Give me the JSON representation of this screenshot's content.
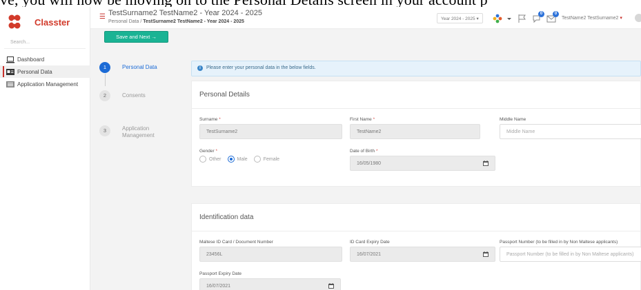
{
  "banner": {
    "text": "ve, you will now be moving on to the Personal Details screen in your account p"
  },
  "brand": {
    "name": "Classter",
    "color": "#d23a2a"
  },
  "sidebar": {
    "search_placeholder": "Search...",
    "items": [
      {
        "label": "Dashboard",
        "icon": "monitor-icon"
      },
      {
        "label": "Personal Data",
        "icon": "id-card-icon"
      },
      {
        "label": "Application Management",
        "icon": "list-icon"
      }
    ]
  },
  "header": {
    "title": "TestSurname2 TestName2 - Year 2024 - 2025",
    "breadcrumb_root": "Personal Data",
    "breadcrumb_sep": "/",
    "breadcrumb_current": "TestSurname2 TestName2 - Year 2024 - 2025",
    "year_select": "Year 2024 - 2025",
    "user_name": "TestName2 TestSurname2",
    "chat_badge": "0",
    "mail_badge": "0"
  },
  "actions": {
    "save_next": "Save and Next →"
  },
  "steps": [
    {
      "number": "1",
      "label": "Personal Data"
    },
    {
      "number": "2",
      "label": "Consents"
    },
    {
      "number": "3",
      "label": "Application Management"
    }
  ],
  "alert": {
    "text": "Please enter your personal data in the below fields."
  },
  "personal": {
    "title": "Personal Details",
    "surname_label": "Surname",
    "surname_value": "TestSurname2",
    "firstname_label": "First Name",
    "firstname_value": "TestName2",
    "middlename_label": "Middle Name",
    "middlename_placeholder": "Middle Name",
    "gender_label": "Gender",
    "gender_options": [
      "Other",
      "Male",
      "Female"
    ],
    "gender_selected": "Male",
    "dob_label": "Date of Birth",
    "dob_value": "16/05/1980",
    "required_mark": "*"
  },
  "identification": {
    "title": "Identification data",
    "id_label": "Maltese ID Card / Document Number",
    "id_value": "23456L",
    "id_expiry_label": "ID Card Expiry Date",
    "id_expiry_value": "16/07/2021",
    "passport_label": "Passport Number (to be filled in by Non Maltese applicants)",
    "passport_placeholder": "Passport Number (to be filled in by Non Maltese applicants)",
    "passport_expiry_label": "Passport Expiry Date",
    "passport_expiry_value": "16/07/2021"
  },
  "colors": {
    "accent": "#1c6bd6",
    "save": "#1ab394",
    "brand_red": "#c8312b"
  }
}
